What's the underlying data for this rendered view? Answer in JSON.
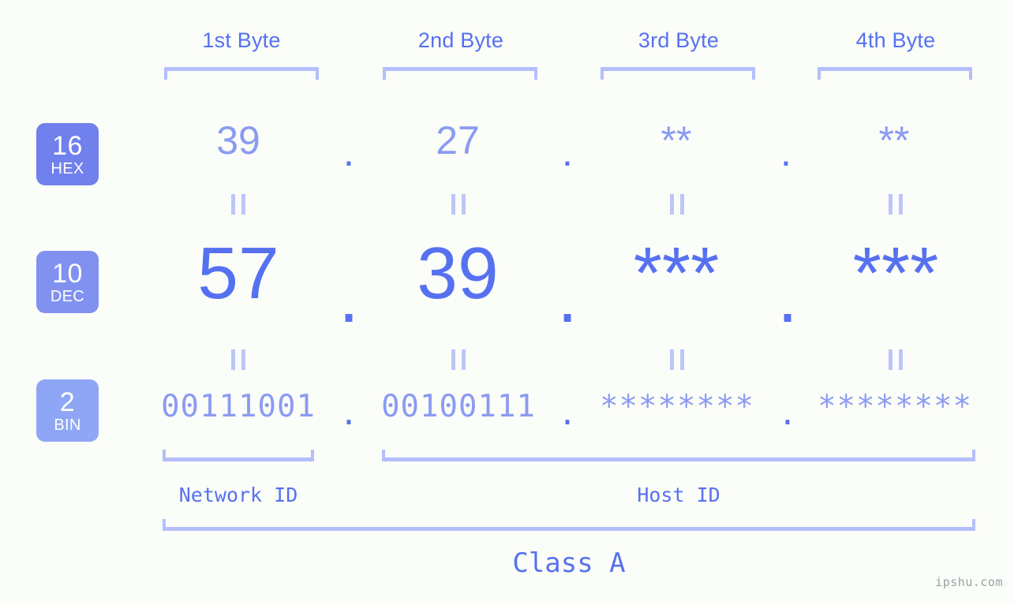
{
  "meta": {
    "background": "#fbfdf9",
    "accent_strong": "#5671f0",
    "accent_mid": "#8b9bf2",
    "accent_light": "#b4bffb",
    "watermark": "ipshu.com"
  },
  "headers": [
    {
      "label": "1st Byte"
    },
    {
      "label": "2nd Byte"
    },
    {
      "label": "3rd Byte"
    },
    {
      "label": "4th Byte"
    }
  ],
  "rows": {
    "hex": {
      "badge_num": "16",
      "badge_abbr": "HEX",
      "badge_color": "#7080ec",
      "values": [
        "39",
        "27",
        "**",
        "**"
      ],
      "separator": "."
    },
    "dec": {
      "badge_num": "10",
      "badge_abbr": "DEC",
      "badge_color": "#8191f0",
      "values": [
        "57",
        "39",
        "***",
        "***"
      ],
      "separator": "."
    },
    "bin": {
      "badge_num": "2",
      "badge_abbr": "BIN",
      "badge_color": "#8ea6f5",
      "values": [
        "00111001",
        "00100111",
        "********",
        "********"
      ],
      "separator": "."
    }
  },
  "equals_symbol": "=",
  "footer": {
    "network_label": "Network ID",
    "host_label": "Host ID",
    "class_label": "Class A"
  }
}
